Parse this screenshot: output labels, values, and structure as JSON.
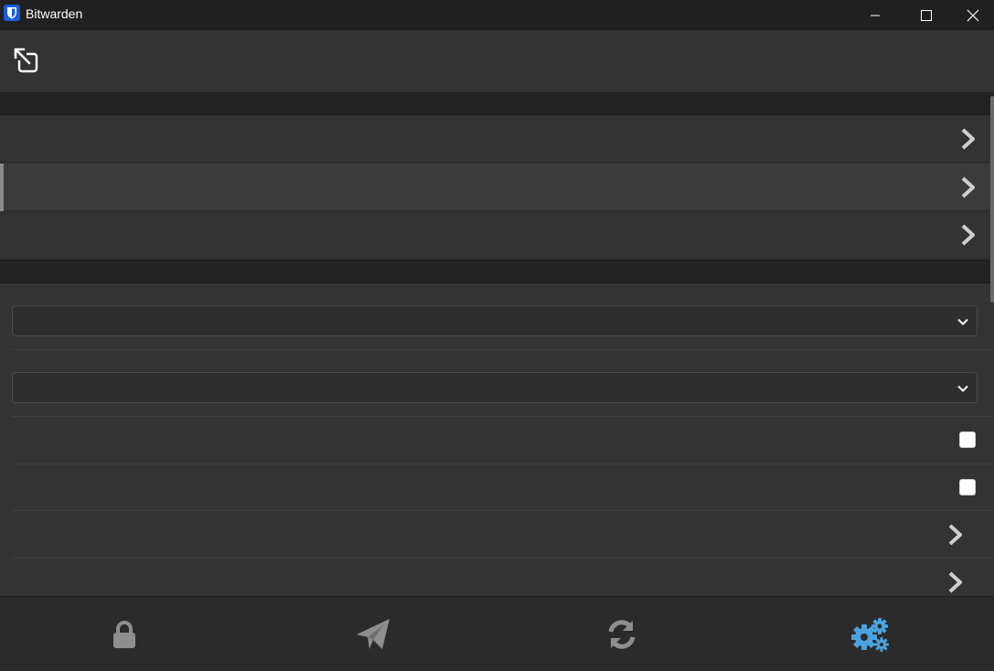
{
  "window": {
    "title": "Bitwarden"
  },
  "colors": {
    "accent": "#3c8dbc",
    "tab_inactive": "#8e8e8e",
    "background": "#333333"
  },
  "settings": {
    "nav_rows": [
      {
        "icon": "chevron-right-icon",
        "selected": false
      },
      {
        "icon": "chevron-right-icon",
        "selected": true
      },
      {
        "icon": "chevron-right-icon",
        "selected": false
      }
    ],
    "selects": [
      {
        "icon": "chevron-down-icon"
      },
      {
        "icon": "chevron-down-icon"
      }
    ],
    "checkboxes": [
      {
        "checked": false
      },
      {
        "checked": false
      }
    ],
    "link_rows": [
      {
        "icon": "chevron-right-icon"
      },
      {
        "icon": "chevron-right-icon"
      }
    ]
  },
  "tabs": [
    {
      "icon": "lock-icon",
      "active": false
    },
    {
      "icon": "send-icon",
      "active": false
    },
    {
      "icon": "sync-icon",
      "active": false
    },
    {
      "icon": "settings-cogs-icon",
      "active": true
    }
  ]
}
